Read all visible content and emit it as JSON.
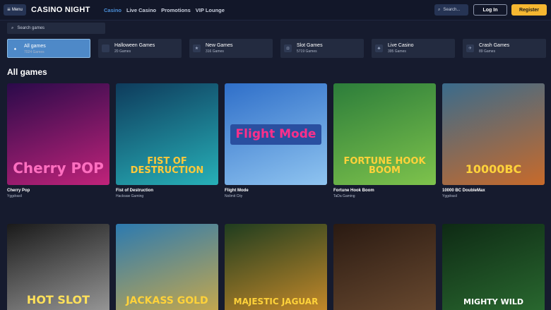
{
  "header": {
    "menu_label": "Menu",
    "logo_text": "CASINO NIGHT",
    "nav": [
      {
        "label": "Casino",
        "active": true
      },
      {
        "label": "Live Casino",
        "active": false
      },
      {
        "label": "Promotions",
        "active": false
      },
      {
        "label": "VIP Lounge",
        "active": false
      }
    ],
    "search_placeholder": "Search...",
    "login_label": "Log In",
    "register_label": "Register"
  },
  "search": {
    "placeholder": "Search games"
  },
  "categories": [
    {
      "name": "All games",
      "count": "7024 Games",
      "active": true,
      "icon": "cards-icon"
    },
    {
      "name": "Halloween Games",
      "count": "20 Games",
      "active": false,
      "icon": "pumpkin-icon"
    },
    {
      "name": "New Games",
      "count": "316 Games",
      "active": false,
      "icon": "star-icon"
    },
    {
      "name": "Slot Games",
      "count": "5719 Games",
      "active": false,
      "icon": "slot-icon"
    },
    {
      "name": "Live Casino",
      "count": "395 Games",
      "active": false,
      "icon": "dealer-icon"
    },
    {
      "name": "Crash Games",
      "count": "89 Games",
      "active": false,
      "icon": "plane-icon"
    }
  ],
  "section_title": "All games",
  "games": [
    {
      "name": "Cherry Pop",
      "provider": "Yggdrasil",
      "art": "Cherry POP",
      "colors": [
        "#2a0a4a",
        "#c0237a"
      ]
    },
    {
      "name": "Fist of Destruction",
      "provider": "Hacksaw Gaming",
      "art": "FIST OF DESTRUCTION",
      "colors": [
        "#0e3b5c",
        "#27b0b8"
      ]
    },
    {
      "name": "Flight Mode",
      "provider": "Nolimit City",
      "art": "Flight Mode",
      "colors": [
        "#2f6fc9",
        "#8fc4f0"
      ]
    },
    {
      "name": "Fortune Hook Boom",
      "provider": "TaDa Gaming",
      "art": "FORTUNE HOOK BOOM",
      "colors": [
        "#2c7d3a",
        "#7ec34c"
      ]
    },
    {
      "name": "10000 BC DoubleMax",
      "provider": "Yggdrasil",
      "art": "10000BC",
      "colors": [
        "#3a6b8c",
        "#c86a2a"
      ]
    },
    {
      "name": "",
      "provider": "",
      "art": "HOT SLOT",
      "colors": [
        "#1a1a1a",
        "#9a9a9a"
      ]
    },
    {
      "name": "",
      "provider": "",
      "art": "JACKASS GOLD",
      "colors": [
        "#2c7ab0",
        "#c9a94a"
      ]
    },
    {
      "name": "",
      "provider": "",
      "art": "MAJESTIC JAGUAR",
      "colors": [
        "#1f3d1f",
        "#c98b2a"
      ]
    },
    {
      "name": "",
      "provider": "",
      "art": "",
      "colors": [
        "#2a1a12",
        "#6a4a30"
      ]
    },
    {
      "name": "",
      "provider": "",
      "art": "MIGHTY WILD",
      "colors": [
        "#0e2a14",
        "#2a6a30"
      ]
    }
  ]
}
